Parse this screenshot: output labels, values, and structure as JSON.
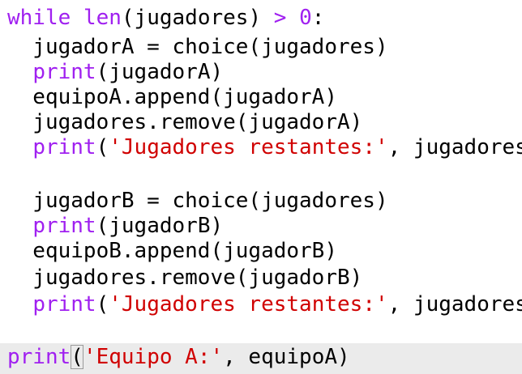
{
  "code": {
    "line1": {
      "kw": "while",
      "mid": " ",
      "fn": "len",
      "rest": "(jugadores) ",
      "op": ">",
      "sp": " ",
      "num": "0",
      "end": ":"
    },
    "line2": {
      "text": "  jugadorA = choice(jugadores)"
    },
    "line3": {
      "indent": "  ",
      "kw": "print",
      "rest": "(jugadorA)"
    },
    "line4": {
      "text": "  equipoA.append(jugadorA)"
    },
    "line5": {
      "text": "  jugadores.remove(jugadorA)"
    },
    "line6": {
      "indent": "  ",
      "kw": "print",
      "open": "(",
      "str": "'Jugadores restantes:'",
      "rest": ", jugadores)"
    },
    "line7": {
      "text": ""
    },
    "line8": {
      "text": "  jugadorB = choice(jugadores)"
    },
    "line9": {
      "indent": "  ",
      "kw": "print",
      "rest": "(jugadorB)"
    },
    "line10": {
      "text": "  equipoB.append(jugadorB)"
    },
    "line11": {
      "text": "  jugadores.remove(jugadorB)"
    },
    "line12": {
      "indent": "  ",
      "kw": "print",
      "open": "(",
      "str": "'Jugadores restantes:'",
      "rest": ", jugadores)"
    },
    "line13": {
      "text": ""
    },
    "line14": {
      "kw": "print",
      "open": "(",
      "str": "'Equipo A:'",
      "rest": ", equipoA)"
    }
  },
  "colors": {
    "keyword": "#a020f0",
    "string": "#d00000",
    "current_line": "#ebebeb"
  }
}
